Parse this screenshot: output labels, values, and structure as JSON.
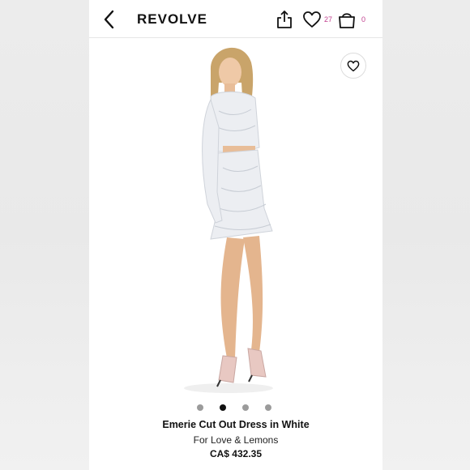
{
  "header": {
    "brand": "REVOLVE",
    "wishlist_count": "27",
    "bag_count": "0"
  },
  "icons": {
    "back": "chevron-left-icon",
    "share": "share-icon",
    "wishlist": "heart-icon",
    "bag": "shopping-bag-icon",
    "favorite": "heart-icon"
  },
  "gallery": {
    "image_count": 4,
    "active_index": 1
  },
  "product": {
    "name": "Emerie Cut Out Dress in White",
    "designer": "For Love & Lemons",
    "price": "CA$ 432.35"
  },
  "colors": {
    "accent": "#c2408f",
    "text": "#111111",
    "dot_inactive": "#9b9b9b",
    "dot_active": "#111111"
  }
}
